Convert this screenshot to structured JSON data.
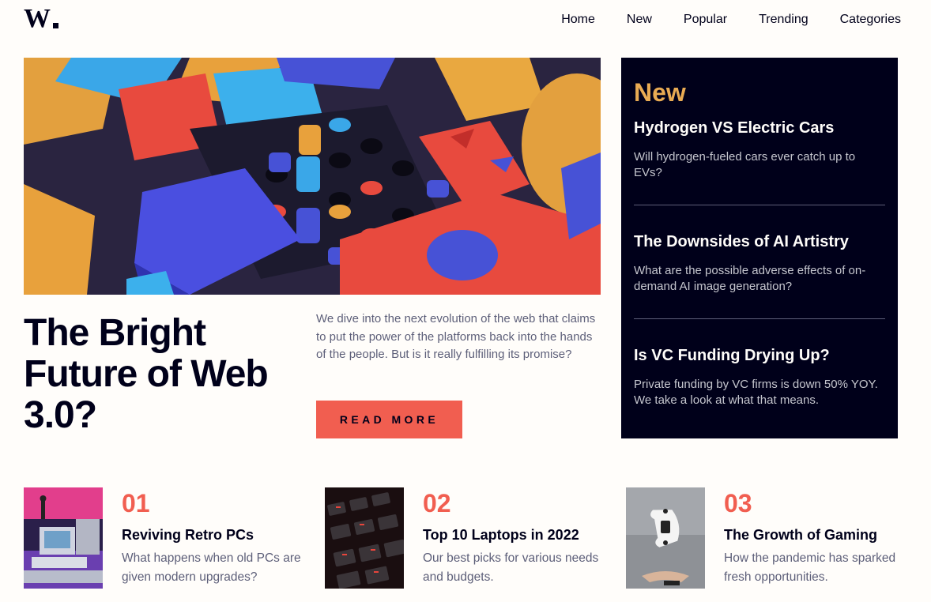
{
  "header": {
    "logo_text": "W.",
    "nav": [
      {
        "label": "Home"
      },
      {
        "label": "New"
      },
      {
        "label": "Popular"
      },
      {
        "label": "Trending"
      },
      {
        "label": "Categories"
      }
    ]
  },
  "hero": {
    "title": "The Bright Future of Web 3.0?",
    "description": "We dive into the next evolution of the web that claims to put the power of the platforms back into the hands of the people. But is it really fulfilling its promise?",
    "cta_label": "READ MORE"
  },
  "new_panel": {
    "heading": "New",
    "items": [
      {
        "title": "Hydrogen VS Electric Cars",
        "description": "Will hydrogen-fueled cars ever catch up to EVs?"
      },
      {
        "title": "The Downsides of AI Artistry",
        "description": "What are the possible adverse effects of on-demand AI image generation?"
      },
      {
        "title": "Is VC Funding Drying Up?",
        "description": "Private funding by VC firms is down 50% YOY. We take a look at what that means."
      }
    ]
  },
  "cards": [
    {
      "number": "01",
      "title": "Reviving Retro PCs",
      "description": "What happens when old PCs are given modern upgrades?"
    },
    {
      "number": "02",
      "title": "Top 10 Laptops in 2022",
      "description": "Our best picks for various needs and budgets."
    },
    {
      "number": "03",
      "title": "The Growth of Gaming",
      "description": "How the pandemic has sparked fresh opportunities."
    }
  ],
  "colors": {
    "dark_navy": "#00001a",
    "soft_orange": "#e9ab53",
    "soft_red": "#f15e50",
    "grayish_blue": "#5d5f79",
    "off_white": "#fffdfa"
  }
}
